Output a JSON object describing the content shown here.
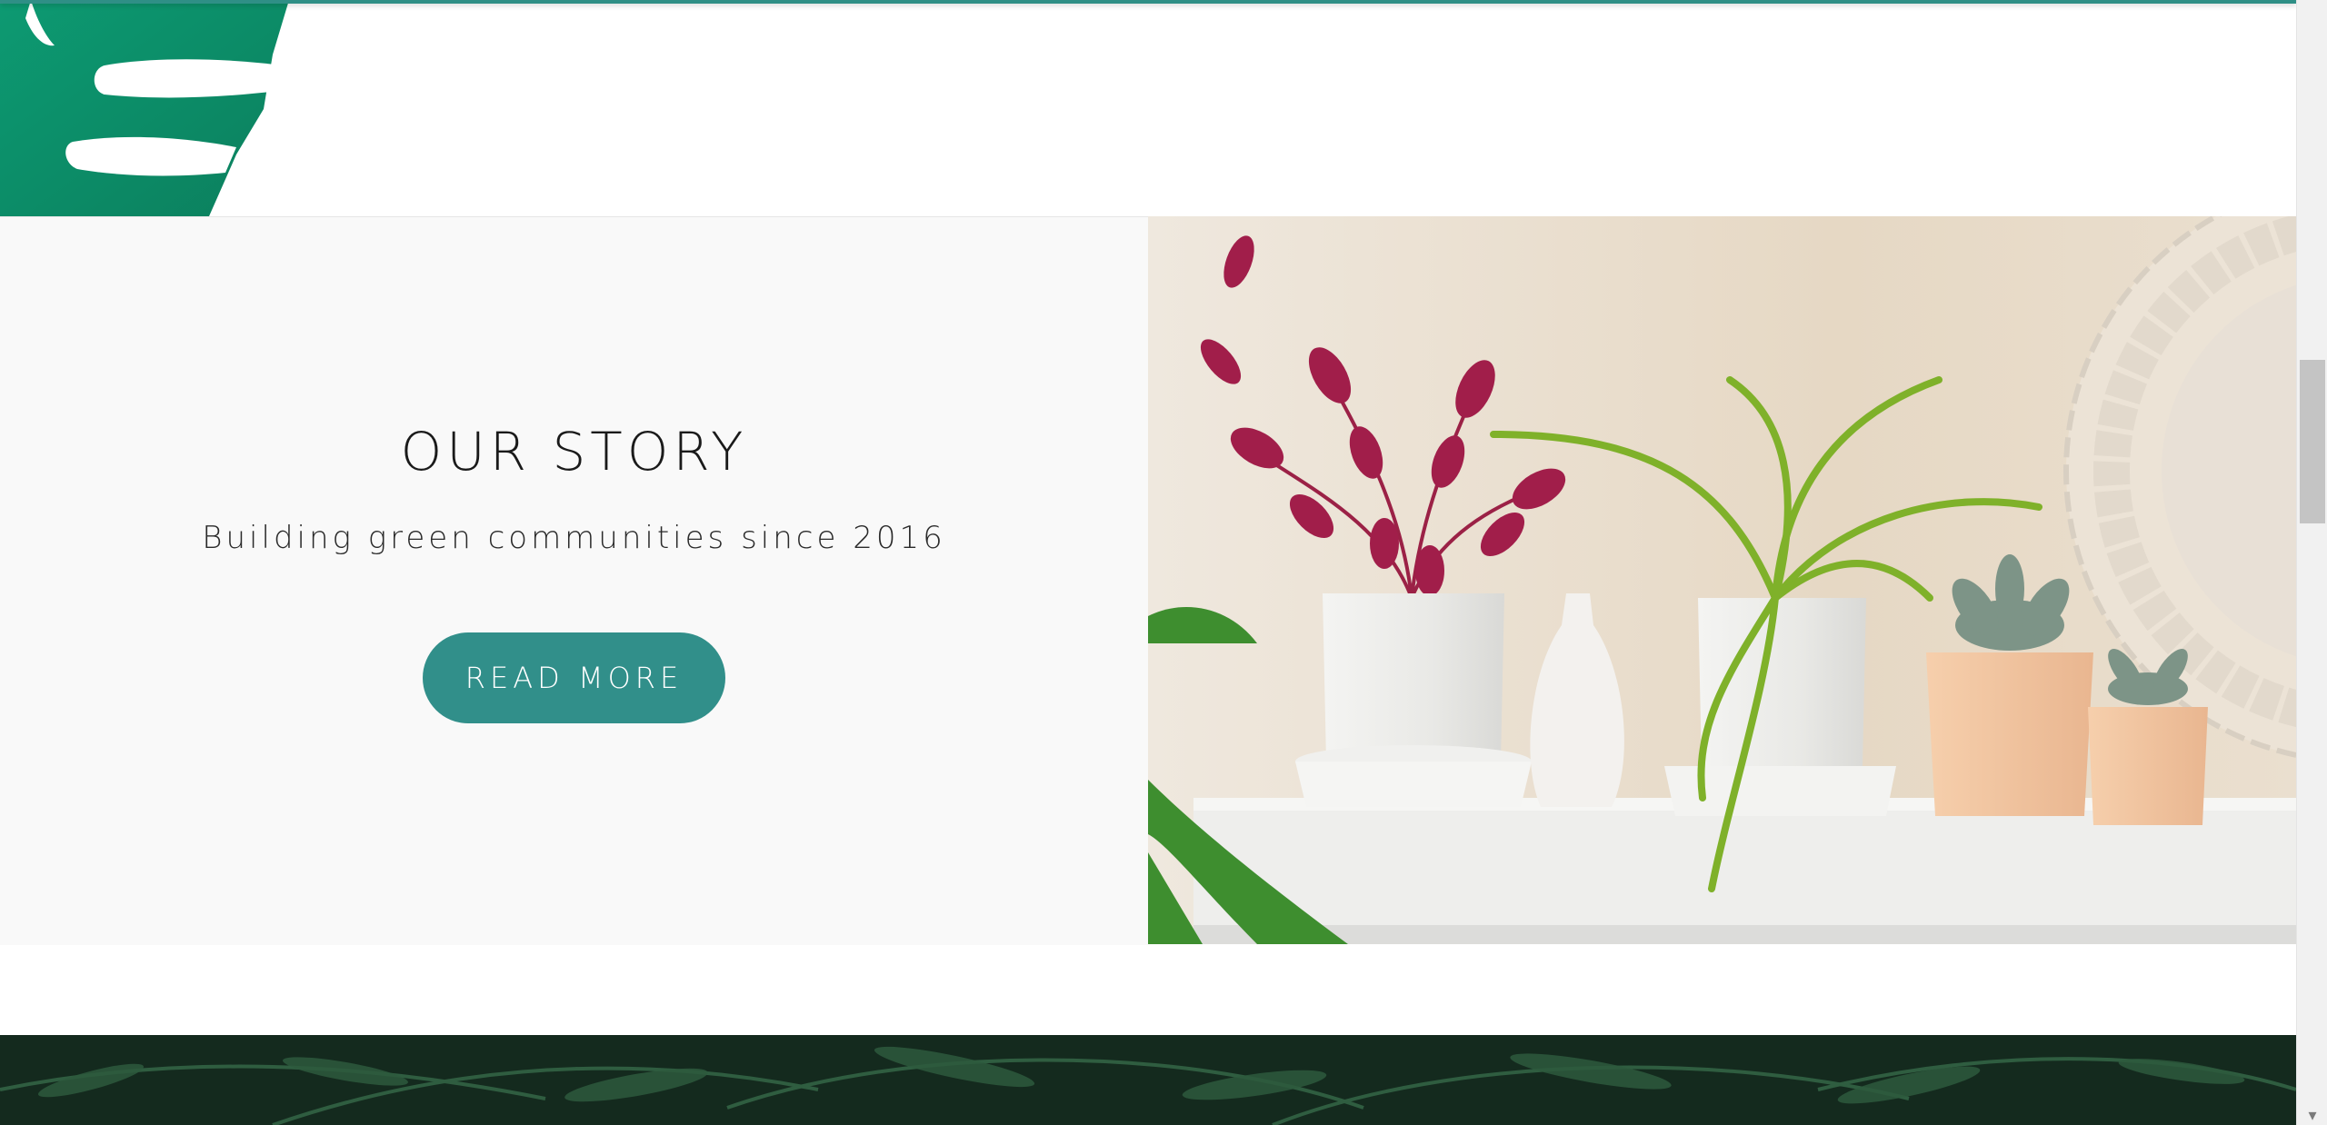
{
  "story": {
    "title": "OUR STORY",
    "subtitle": "Building green communities since 2016",
    "button_label": "READ MORE"
  },
  "colors": {
    "accent": "#318f8a",
    "leaf": "#0f9a73",
    "panel_bg": "#f9f9f9",
    "photo_wall": "#e8dccb"
  },
  "icons": {
    "scroll_down": "▾"
  }
}
